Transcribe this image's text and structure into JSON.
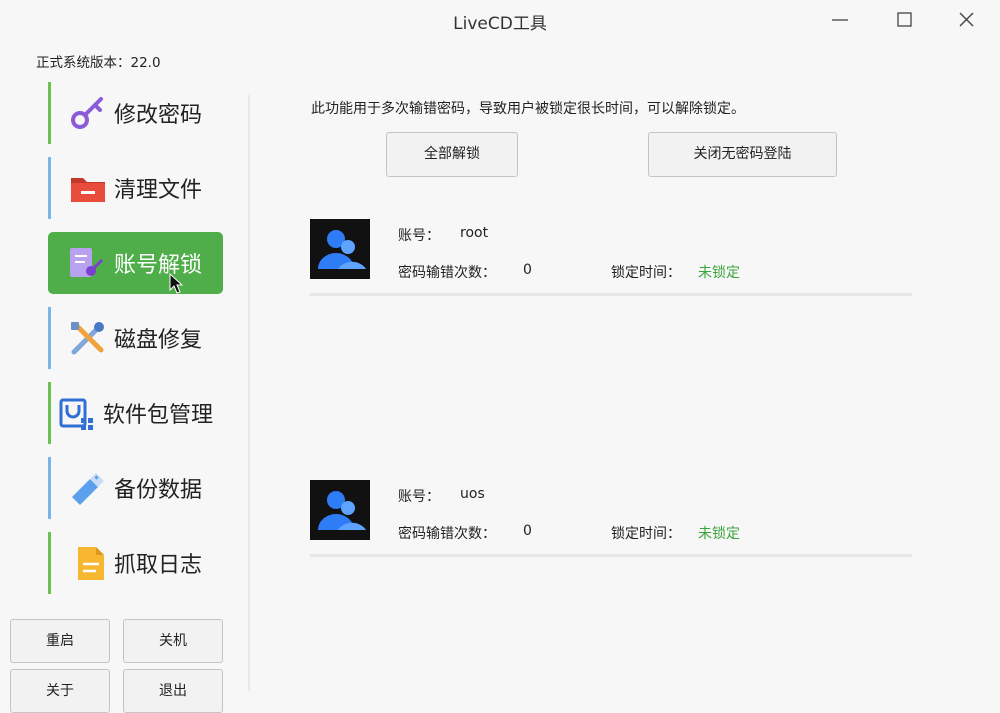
{
  "window": {
    "title": "LiveCD工具"
  },
  "version_text": "正式系统版本：22.0",
  "nav": [
    {
      "label": "修改密码",
      "icon": "key-icon",
      "active": false
    },
    {
      "label": "清理文件",
      "icon": "folder-icon",
      "active": false
    },
    {
      "label": "账号解锁",
      "icon": "account-unlock-icon",
      "active": true
    },
    {
      "label": "磁盘修复",
      "icon": "tools-icon",
      "active": false
    },
    {
      "label": "软件包管理",
      "icon": "package-icon",
      "active": false
    },
    {
      "label": "备份数据",
      "icon": "usb-drive-icon",
      "active": false
    },
    {
      "label": "抓取日志",
      "icon": "document-icon",
      "active": false
    }
  ],
  "footer_buttons": {
    "restart": "重启",
    "shutdown": "关机",
    "about": "关于",
    "exit": "退出"
  },
  "main": {
    "description": "此功能用于多次输错密码，导致用户被锁定很长时间，可以解除锁定。",
    "unlock_all_label": "全部解锁",
    "disable_passwordless_label": "关闭无密码登陆",
    "accounts": [
      {
        "account_label": "账号：",
        "account": "root",
        "errors_label": "密码输错次数：",
        "errors": "0",
        "lock_label": "锁定时间：",
        "lock_status": "未锁定"
      },
      {
        "account_label": "账号：",
        "account": "uos",
        "errors_label": "密码输错次数：",
        "errors": "0",
        "lock_label": "锁定时间：",
        "lock_status": "未锁定"
      }
    ]
  },
  "colors": {
    "accent_green": "#4fae4a",
    "status_green": "#3ba33b",
    "nav_bar_green": "#6cc153",
    "nav_bar_blue": "#7ab5e6"
  }
}
